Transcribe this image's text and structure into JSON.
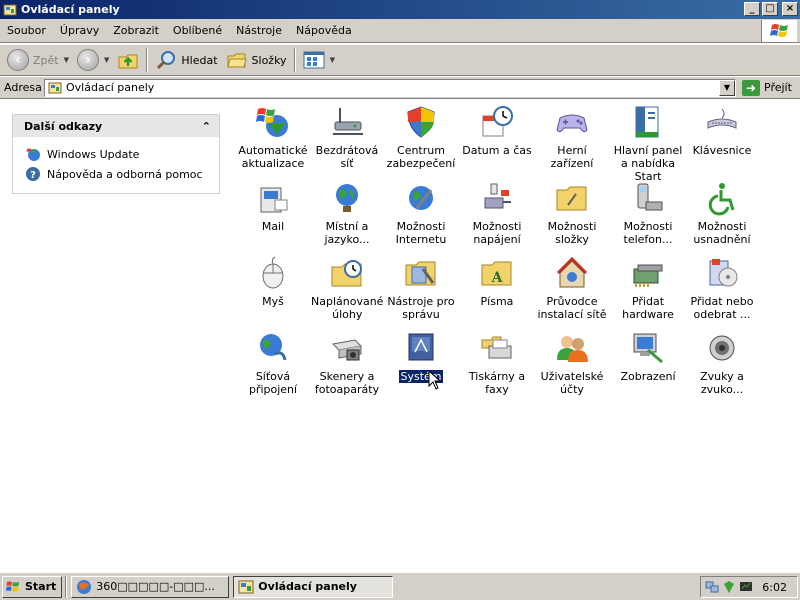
{
  "window": {
    "title": "Ovládací panely",
    "buttons": {
      "minimize": "_",
      "maximize": "□",
      "close": "×"
    }
  },
  "menubar": [
    "Soubor",
    "Úpravy",
    "Zobrazit",
    "Oblíbené",
    "Nástroje",
    "Nápověda"
  ],
  "toolbar": {
    "back_label": "Zpět",
    "search_label": "Hledat",
    "folders_label": "Složky"
  },
  "address": {
    "label": "Adresa",
    "value": "Ovládací panely",
    "go_label": "Přejít"
  },
  "sidepanel": {
    "title": "Další odkazy",
    "links": [
      "Windows Update",
      "Nápověda a odborná pomoc"
    ]
  },
  "items": [
    {
      "label": "Automatické aktualizace",
      "icon": "automatic-updates-icon"
    },
    {
      "label": "Bezdrátová síť",
      "icon": "wireless-network-icon"
    },
    {
      "label": "Centrum zabezpečení",
      "icon": "security-center-icon"
    },
    {
      "label": "Datum a čas",
      "icon": "date-time-icon"
    },
    {
      "label": "Herní zařízení",
      "icon": "game-controller-icon"
    },
    {
      "label": "Hlavní panel a nabídka Start",
      "icon": "taskbar-start-menu-icon"
    },
    {
      "label": "Klávesnice",
      "icon": "keyboard-icon"
    },
    {
      "label": "Mail",
      "icon": "mail-icon"
    },
    {
      "label": "Místní a jazyko...",
      "icon": "regional-language-icon"
    },
    {
      "label": "Možnosti Internetu",
      "icon": "internet-options-icon"
    },
    {
      "label": "Možnosti napájení",
      "icon": "power-options-icon"
    },
    {
      "label": "Možnosti složky",
      "icon": "folder-options-icon"
    },
    {
      "label": "Možnosti telefon...",
      "icon": "phone-modem-icon"
    },
    {
      "label": "Možnosti usnadnění",
      "icon": "accessibility-icon"
    },
    {
      "label": "Myš",
      "icon": "mouse-icon"
    },
    {
      "label": "Naplánované úlohy",
      "icon": "scheduled-tasks-icon"
    },
    {
      "label": "Nástroje pro správu",
      "icon": "administrative-tools-icon"
    },
    {
      "label": "Písma",
      "icon": "fonts-icon"
    },
    {
      "label": "Průvodce instalací sítě",
      "icon": "network-setup-wizard-icon"
    },
    {
      "label": "Přidat hardware",
      "icon": "add-hardware-icon"
    },
    {
      "label": "Přidat nebo odebrat ...",
      "icon": "add-remove-programs-icon"
    },
    {
      "label": "Síťová připojení",
      "icon": "network-connections-icon"
    },
    {
      "label": "Skenery a fotoaparáty",
      "icon": "scanners-cameras-icon"
    },
    {
      "label": "Systém",
      "icon": "system-icon",
      "selected": true
    },
    {
      "label": "Tiskárny a faxy",
      "icon": "printers-faxes-icon"
    },
    {
      "label": "Uživatelské účty",
      "icon": "user-accounts-icon"
    },
    {
      "label": "Zobrazení",
      "icon": "display-icon"
    },
    {
      "label": "Zvuky a zvuko...",
      "icon": "sounds-audio-icon"
    }
  ],
  "taskbar": {
    "start_label": "Start",
    "tasks": [
      "360□□□□□-□□□...",
      "Ovládací panely"
    ],
    "clock": "6:02"
  }
}
